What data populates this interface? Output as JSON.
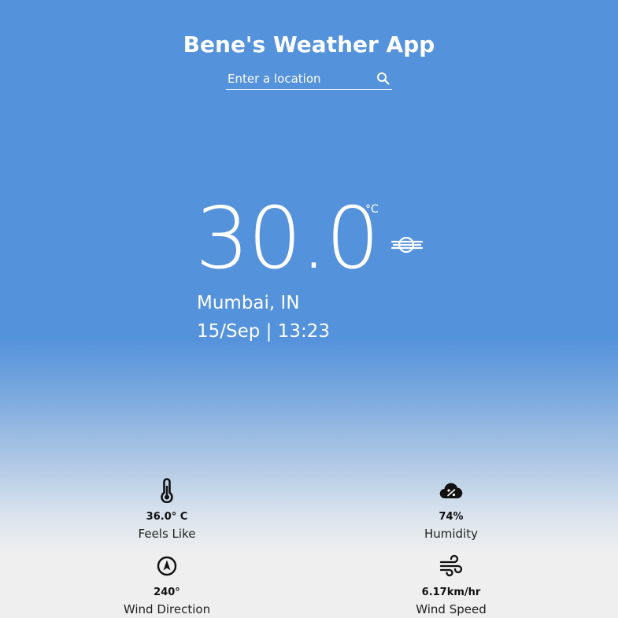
{
  "app": {
    "title": "Bene's Weather App"
  },
  "search": {
    "placeholder": "Enter a location",
    "icon": "search-icon"
  },
  "current": {
    "temperature": "30.0",
    "unit": "°C",
    "condition_icon": "haze-icon",
    "location": "Mumbai, IN",
    "datetime": "15/Sep | 13:23"
  },
  "stats": {
    "feels_like": {
      "value": "36.0° C",
      "label": "Feels Like",
      "icon": "thermometer-icon"
    },
    "humidity": {
      "value": "74%",
      "label": "Humidity",
      "icon": "humidity-cloud-icon"
    },
    "wind_direction": {
      "value": "240°",
      "label": "Wind Direction",
      "icon": "compass-icon"
    },
    "wind_speed": {
      "value": "6.17km/hr",
      "label": "Wind Speed",
      "icon": "wind-icon"
    }
  },
  "colors": {
    "sky": "#5492dc",
    "ground": "#efefef",
    "text_light": "#ffffff",
    "text_dark": "#111111"
  }
}
